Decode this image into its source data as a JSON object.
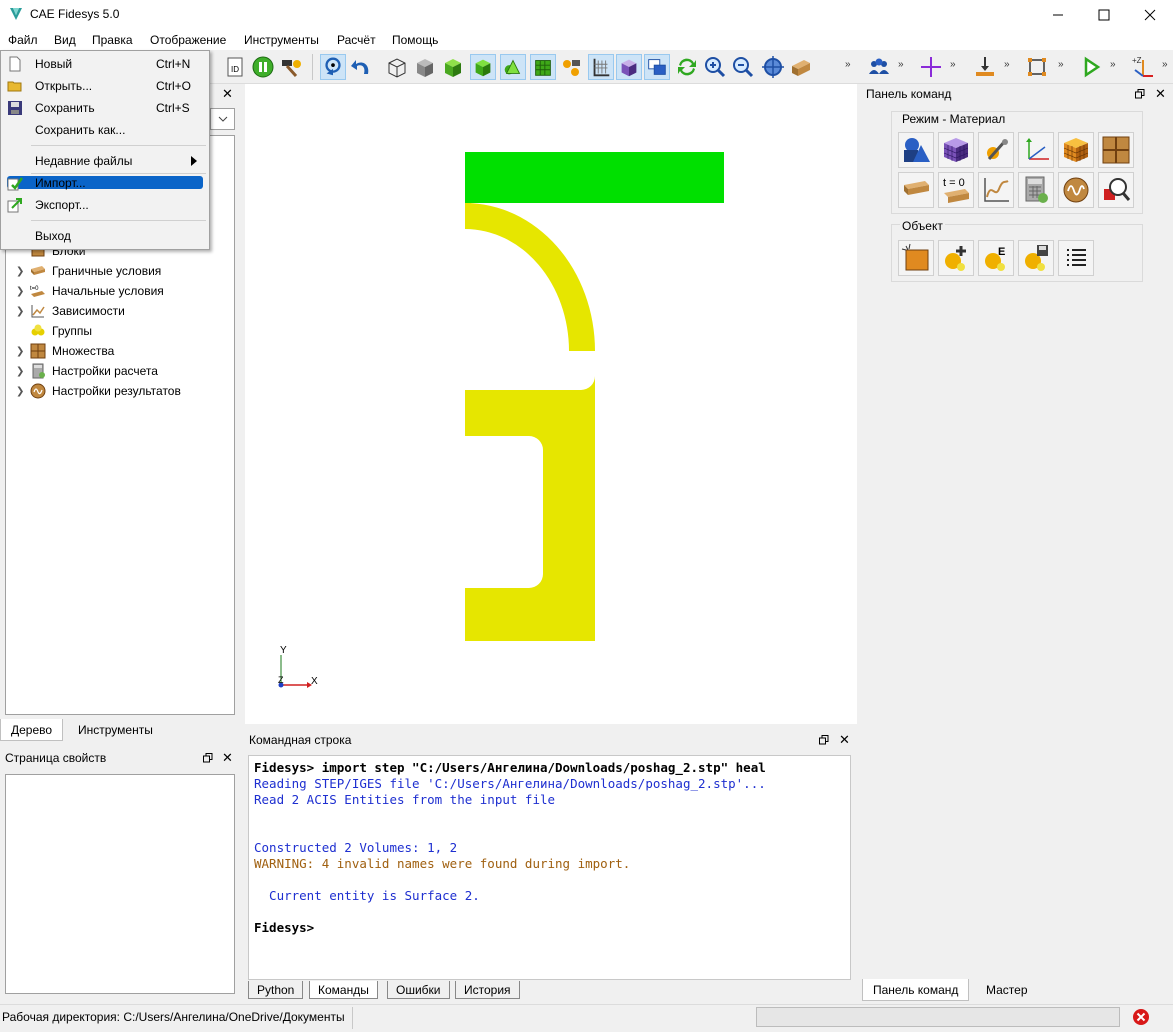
{
  "window": {
    "title": "CAE Fidesys 5.0"
  },
  "menubar": {
    "items": [
      "Файл",
      "Вид",
      "Правка",
      "Отображение",
      "Инструменты",
      "Расчёт",
      "Помощь"
    ]
  },
  "file_menu": {
    "items": [
      {
        "label": "Новый",
        "shortcut": "Ctrl+N"
      },
      {
        "label": "Открыть...",
        "shortcut": "Ctrl+O"
      },
      {
        "label": "Сохранить",
        "shortcut": "Ctrl+S"
      },
      {
        "label": "Сохранить как...",
        "shortcut": ""
      },
      {
        "label": "Недавние файлы",
        "shortcut": ""
      },
      {
        "label": "Импорт...",
        "shortcut": ""
      },
      {
        "label": "Экспорт...",
        "shortcut": ""
      },
      {
        "label": "Выход",
        "shortcut": ""
      }
    ],
    "highlighted": "Импорт..."
  },
  "tree": {
    "items": [
      {
        "label": "Блоки",
        "expandable": false
      },
      {
        "label": "Граничные условия",
        "expandable": true
      },
      {
        "label": "Начальные условия",
        "expandable": true
      },
      {
        "label": "Зависимости",
        "expandable": true
      },
      {
        "label": "Группы",
        "expandable": false
      },
      {
        "label": "Множества",
        "expandable": true
      },
      {
        "label": "Настройки расчета",
        "expandable": true
      },
      {
        "label": "Настройки результатов",
        "expandable": true
      }
    ],
    "tabs": [
      "Дерево",
      "Инструменты"
    ]
  },
  "properties": {
    "title": "Страница свойств"
  },
  "viewport": {
    "axes": {
      "x": "X",
      "y": "Y",
      "z": "Z"
    },
    "colors": {
      "plate": "#00e000",
      "part": "#e6e600"
    }
  },
  "command_line": {
    "title": "Командная строка",
    "lines": [
      {
        "text": "Fidesys> import step \"C:/Users/Ангелина/Downloads/poshag_2.stp\" heal",
        "kind": "prompt"
      },
      {
        "text": "Reading STEP/IGES file 'C:/Users/Ангелина/Downloads/poshag_2.stp'...",
        "kind": "info"
      },
      {
        "text": "Read 2 ACIS Entities from the input file",
        "kind": "info"
      },
      {
        "text": "",
        "kind": "blank"
      },
      {
        "text": "",
        "kind": "blank"
      },
      {
        "text": "Constructed 2 Volumes: 1, 2",
        "kind": "info"
      },
      {
        "text": "WARNING: 4 invalid names were found during import.",
        "kind": "warning"
      },
      {
        "text": "",
        "kind": "blank"
      },
      {
        "text": "  Current entity is Surface 2.",
        "kind": "info"
      },
      {
        "text": "",
        "kind": "blank"
      },
      {
        "text": "Fidesys>",
        "kind": "prompt"
      }
    ],
    "tabs": [
      "Python",
      "Команды",
      "Ошибки",
      "История"
    ],
    "active_tab": "Команды"
  },
  "command_panel": {
    "title": "Панель команд",
    "mode_group": "Режим - Материал",
    "object_group": "Объект",
    "time_label": "t = 0",
    "tabs": [
      "Панель команд",
      "Мастер"
    ]
  },
  "status": {
    "working_dir": "Рабочая директория: C:/Users/Ангелина/OneDrive/Документы"
  }
}
